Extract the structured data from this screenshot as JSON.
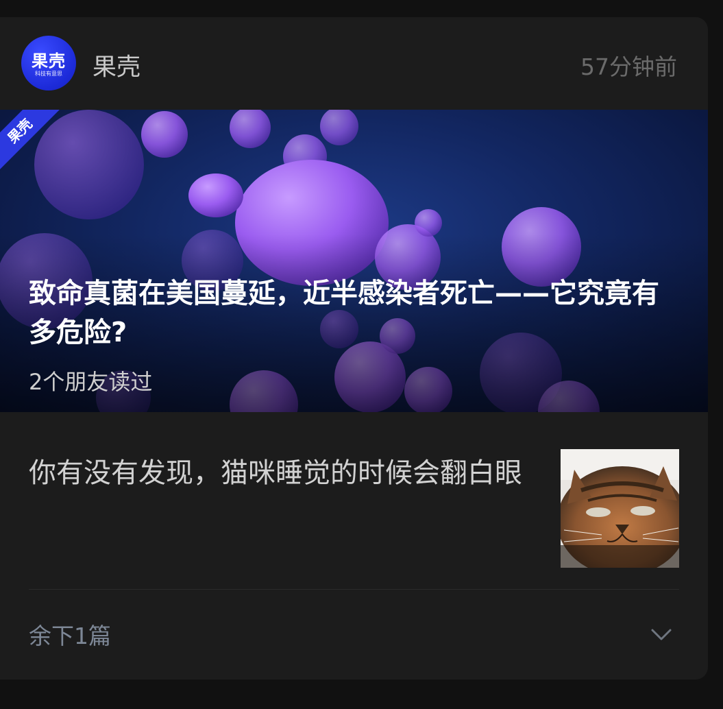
{
  "header": {
    "avatar_text": "果壳",
    "avatar_subtext": "科技有意思",
    "account_name": "果壳",
    "time": "57分钟前"
  },
  "hero": {
    "corner_tag": "果壳",
    "title": "致命真菌在美国蔓延，近半感染者死亡——它究竟有多危险?",
    "meta": "2个朋友读过"
  },
  "article": {
    "title": "你有没有发现，猫咪睡觉的时候会翻白眼"
  },
  "footer": {
    "remaining": "余下1篇"
  },
  "colors": {
    "card_bg": "#1c1c1c",
    "page_bg": "#111111",
    "brand_blue": "#2c39e0",
    "secondary_text": "#7d8796"
  },
  "icons": {
    "expand": "chevron-down-icon"
  }
}
